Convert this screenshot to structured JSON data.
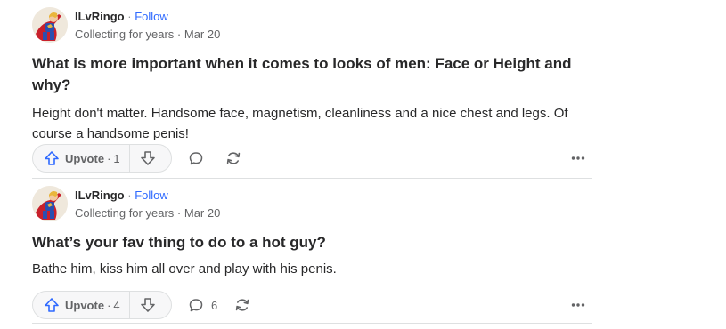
{
  "posts": [
    {
      "author": {
        "name": "ILvRingo",
        "separator": "·",
        "follow_label": "Follow",
        "credential": "Collecting for years",
        "date_separator": "·",
        "date": "Mar 20"
      },
      "question": "What is more important when it comes to looks of men: Face or Height and why?",
      "answer": "Height don't matter. Handsome face, magnetism, cleanliness and a nice chest and legs. Of course a handsome penis!",
      "actions": {
        "upvote_label": "Upvote",
        "upvote_separator": "·",
        "upvote_count": "1",
        "comment_count": ""
      }
    },
    {
      "author": {
        "name": "ILvRingo",
        "separator": "·",
        "follow_label": "Follow",
        "credential": "Collecting for years",
        "date_separator": "·",
        "date": "Mar 20"
      },
      "question": "What’s your fav thing to do to a hot guy?",
      "answer": "Bathe him, kiss him all over and play with his penis.",
      "actions": {
        "upvote_label": "Upvote",
        "upvote_separator": "·",
        "upvote_count": "4",
        "comment_count": "6"
      }
    }
  ],
  "icons": {
    "avatar": "superhero-avatar",
    "upvote": "arrow-up-icon",
    "downvote": "arrow-down-icon",
    "comment": "speech-bubble-icon",
    "share": "refresh-arrows-icon",
    "more": "ellipsis-icon"
  },
  "colors": {
    "accent": "#2e69ff",
    "text": "#282829",
    "muted": "#636466",
    "border": "#dee0e1",
    "vote_bg": "#f7f7f8"
  }
}
